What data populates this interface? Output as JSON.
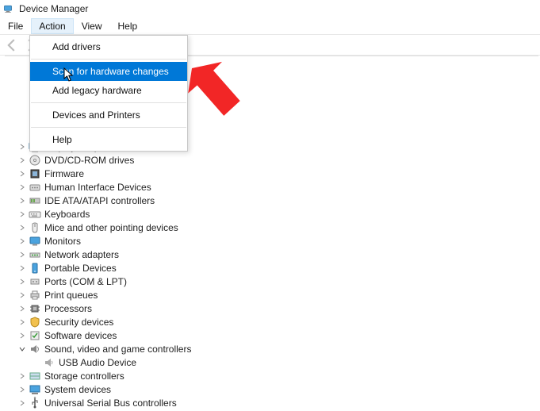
{
  "window": {
    "title": "Device Manager"
  },
  "menubar": {
    "items": [
      {
        "label": "File"
      },
      {
        "label": "Action",
        "open": true
      },
      {
        "label": "View"
      },
      {
        "label": "Help"
      }
    ]
  },
  "dropdown": {
    "items": [
      {
        "type": "item",
        "label": "Add drivers"
      },
      {
        "type": "sep"
      },
      {
        "type": "item",
        "label": "Scan for hardware changes",
        "highlighted": true
      },
      {
        "type": "item",
        "label": "Add legacy hardware"
      },
      {
        "type": "sep"
      },
      {
        "type": "item",
        "label": "Devices and Printers"
      },
      {
        "type": "sep"
      },
      {
        "type": "item",
        "label": "Help"
      }
    ]
  },
  "tree": {
    "root": {
      "label": ""
    },
    "nodes": [
      {
        "icon": "display",
        "label": "Display adapters"
      },
      {
        "icon": "disc",
        "label": "DVD/CD-ROM drives"
      },
      {
        "icon": "firmware",
        "label": "Firmware"
      },
      {
        "icon": "hid",
        "label": "Human Interface Devices"
      },
      {
        "icon": "ide",
        "label": "IDE ATA/ATAPI controllers"
      },
      {
        "icon": "keyboard",
        "label": "Keyboards"
      },
      {
        "icon": "mouse",
        "label": "Mice and other pointing devices"
      },
      {
        "icon": "monitor",
        "label": "Monitors"
      },
      {
        "icon": "network",
        "label": "Network adapters"
      },
      {
        "icon": "portable",
        "label": "Portable Devices"
      },
      {
        "icon": "port",
        "label": "Ports (COM & LPT)"
      },
      {
        "icon": "printer",
        "label": "Print queues"
      },
      {
        "icon": "cpu",
        "label": "Processors"
      },
      {
        "icon": "security",
        "label": "Security devices"
      },
      {
        "icon": "software",
        "label": "Software devices"
      },
      {
        "icon": "sound",
        "label": "Sound, video and game controllers",
        "expanded": true,
        "children": [
          {
            "icon": "speaker",
            "label": "USB Audio Device"
          }
        ]
      },
      {
        "icon": "storage",
        "label": "Storage controllers"
      },
      {
        "icon": "system",
        "label": "System devices"
      },
      {
        "icon": "usb",
        "label": "Universal Serial Bus controllers"
      }
    ]
  },
  "annotation": {
    "type": "red-arrow",
    "target": "dropdown-item-scan-for-hardware-changes"
  }
}
